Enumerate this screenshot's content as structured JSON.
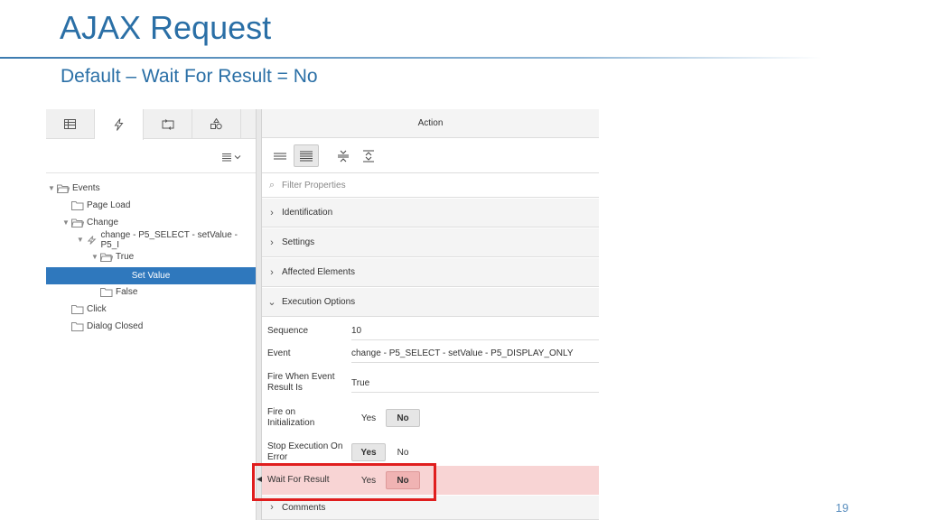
{
  "slide": {
    "title": "AJAX Request",
    "subtitle": "Default – Wait For Result = No",
    "page_number": "19"
  },
  "left_panel": {
    "tabs": [
      {
        "icon": "table-icon"
      },
      {
        "icon": "lightning-icon",
        "active": true
      },
      {
        "icon": "process-icon"
      },
      {
        "icon": "shapes-icon"
      }
    ],
    "menu_icon": "list-menu-icon",
    "tree": [
      {
        "label": "Events"
      },
      {
        "label": "Page Load"
      },
      {
        "label": "Change"
      },
      {
        "label": "change - P5_SELECT - setValue - P5_I"
      },
      {
        "label": "True"
      },
      {
        "label": "Set Value"
      },
      {
        "label": "False"
      },
      {
        "label": "Click"
      },
      {
        "label": "Dialog Closed"
      }
    ]
  },
  "right_panel": {
    "header": "Action",
    "filter_placeholder": "Filter Properties",
    "sections": {
      "identification": "Identification",
      "settings": "Settings",
      "affected_elements": "Affected Elements",
      "execution_options": "Execution Options",
      "comments": "Comments"
    },
    "properties": {
      "sequence": {
        "label": "Sequence",
        "value": "10"
      },
      "event": {
        "label": "Event",
        "value": "change - P5_SELECT - setValue - P5_DISPLAY_ONLY"
      },
      "fire_when": {
        "label": "Fire When Event Result Is",
        "value": "True"
      },
      "fire_on_init": {
        "label": "Fire on Initialization",
        "yes": "Yes",
        "no": "No",
        "selected": "No"
      },
      "stop_exec": {
        "label": "Stop Execution On Error",
        "yes": "Yes",
        "no": "No",
        "selected": "Yes"
      },
      "wait_result": {
        "label": "Wait For Result",
        "yes": "Yes",
        "no": "No",
        "selected": "No"
      }
    }
  },
  "colors": {
    "title": "#2a6fa6",
    "selection": "#2f78bd",
    "highlight": "#e01e1e"
  }
}
